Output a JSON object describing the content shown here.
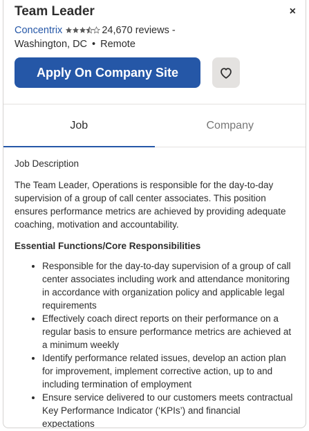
{
  "header": {
    "job_title": "Team Leader",
    "close_label": "×",
    "company_name": "Concentrix",
    "rating": 3.5,
    "reviews": "24,670 reviews",
    "separator": "-",
    "location": "Washington, DC",
    "bullet": "•",
    "work_type": "Remote",
    "apply_label": "Apply On Company Site",
    "save_icon": "heart-icon"
  },
  "tabs": [
    {
      "label": "Job",
      "active": true
    },
    {
      "label": "Company",
      "active": false
    }
  ],
  "description": {
    "section_label": "Job Description",
    "intro": "The Team Leader, Operations is responsible for the day-to-day supervision of a group of call center associates. This position ensures performance metrics are achieved by providing adequate coaching, motivation and accountability.",
    "subheading": "Essential Functions/Core Responsibilities",
    "responsibilities": [
      "Responsible for the day-to-day supervision of a group of call center associates including work and attendance monitoring in accordance with organization policy and applicable legal requirements",
      "Effectively coach direct reports on their performance on a regular basis to ensure performance metrics are achieved at a minimum weekly",
      "Identify performance related issues, develop an action plan for improvement, implement corrective action, up to and including termination of employment",
      "Ensure service delivered to our customers meets contractual Key Performance Indicator (‘KPIs’) and financial expectations"
    ]
  },
  "colors": {
    "accent": "#2557a7",
    "star": "#595959"
  }
}
